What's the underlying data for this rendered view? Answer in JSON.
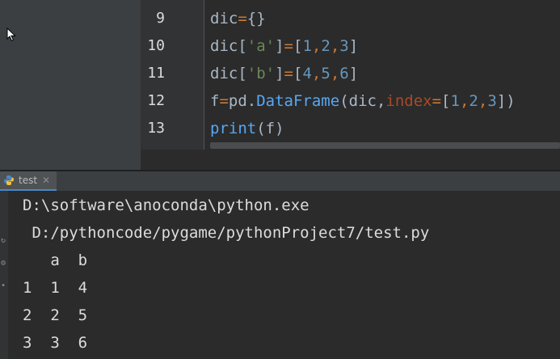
{
  "editor": {
    "line_numbers": [
      "9",
      "10",
      "11",
      "12",
      "13"
    ],
    "line9": {
      "a": "dic",
      "b": "=",
      "c": "{}"
    },
    "line10": {
      "a": "dic[",
      "b": "'a'",
      "c": "]",
      "d": "=",
      "e": "[",
      "f": "1",
      "g": ",",
      "h": "2",
      "i": ",",
      "j": "3",
      "k": "]"
    },
    "line11": {
      "a": "dic[",
      "b": "'b'",
      "c": "]",
      "d": "=",
      "e": "[",
      "f": "4",
      "g": ",",
      "h": "5",
      "i": ",",
      "j": "6",
      "k": "]"
    },
    "line12": {
      "a": "f",
      "b": "=",
      "c": "pd.",
      "d": "DataFrame",
      "e": "(dic,",
      "f": "index",
      "g": "=",
      "h": "[",
      "i": "1",
      "j": ",",
      "k": "2",
      "l": ",",
      "m": "3",
      "n": "])"
    },
    "line13": {
      "a": "print",
      "b": "(f)"
    }
  },
  "run_tab": {
    "label": "test",
    "icon": "python-icon"
  },
  "console": {
    "lines": [
      "D:\\software\\anoconda\\python.exe",
      " D:/pythoncode/pygame/pythonProject7/test.py",
      "   a  b",
      "1  1  4",
      "2  2  5",
      "3  3  6"
    ]
  },
  "colors": {
    "background": "#2b2b2b",
    "keyword_orange": "#cc7832",
    "string_green": "#6a8759",
    "number_blue": "#6897bb",
    "function_blue": "#56a8f5",
    "param_red": "#aa4926"
  }
}
